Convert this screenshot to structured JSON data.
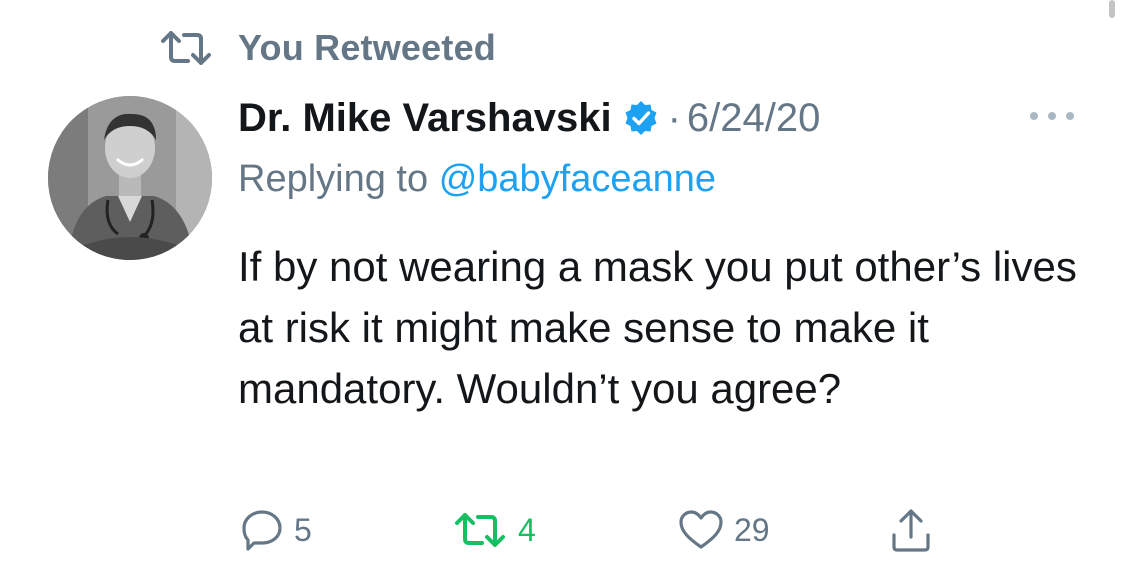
{
  "retweet_context": {
    "label": "You Retweeted",
    "icon": "retweet-icon"
  },
  "tweet": {
    "author": {
      "display_name": "Dr. Mike Varshavski",
      "verified": true,
      "avatar": "avatar"
    },
    "separator": "·",
    "timestamp": "6/24/20",
    "reply_prefix": "Replying to",
    "reply_to": "@babyfaceanne",
    "text": "If by not wearing a mask you put other’s lives at risk it might make sense to make it mandatory. Wouldn’t you agree?",
    "actions": {
      "replies": "5",
      "retweets": "4",
      "likes": "29"
    }
  },
  "colors": {
    "text_primary": "#14171a",
    "text_secondary": "#657786",
    "link": "#1da1f2",
    "verified": "#1da1f2",
    "retweeted": "#17bf63"
  },
  "icons": {
    "more": "more-horizontal-icon",
    "reply": "reply-bubble-icon",
    "retweet": "retweet-icon",
    "like": "heart-icon",
    "share": "share-icon",
    "verified": "verified-badge-icon"
  }
}
